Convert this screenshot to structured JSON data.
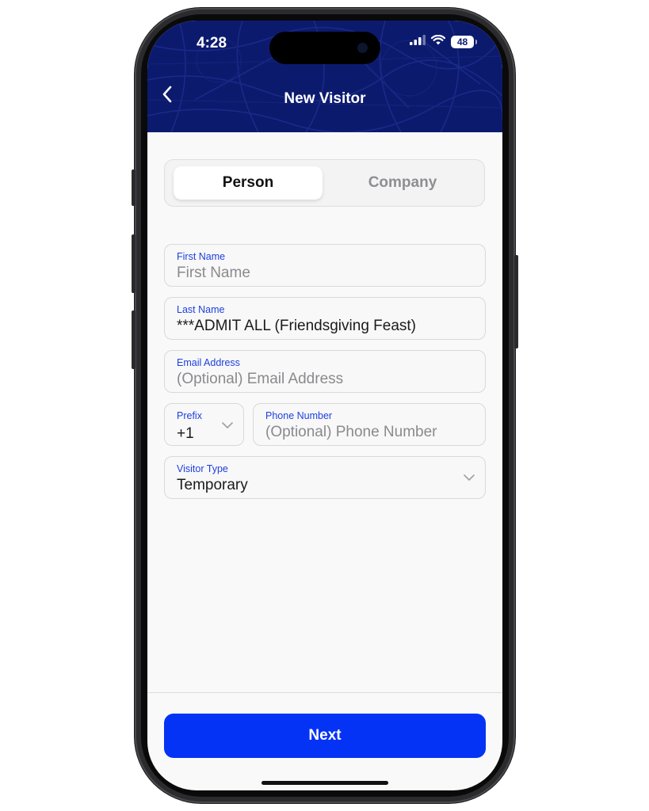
{
  "status_bar": {
    "time": "4:28",
    "battery": "48",
    "icons": [
      "signal-icon",
      "wifi-icon",
      "battery-icon"
    ]
  },
  "header": {
    "title": "New Visitor",
    "back_icon": "chevron-left-icon",
    "background_color": "#0c1a6e"
  },
  "segmented": {
    "options": [
      "Person",
      "Company"
    ],
    "selected": "Person"
  },
  "form": {
    "first_name": {
      "label": "First Name",
      "placeholder": "First Name",
      "value": ""
    },
    "last_name": {
      "label": "Last Name",
      "value": "***ADMIT ALL (Friendsgiving Feast)"
    },
    "email": {
      "label": "Email Address",
      "placeholder": "(Optional) Email Address",
      "value": ""
    },
    "prefix": {
      "label": "Prefix",
      "value": "+1"
    },
    "phone": {
      "label": "Phone Number",
      "placeholder": "(Optional) Phone Number",
      "value": ""
    },
    "visitor_type": {
      "label": "Visitor Type",
      "value": "Temporary"
    }
  },
  "footer": {
    "next_label": "Next"
  },
  "colors": {
    "accent": "#0433f5",
    "label_blue": "#1d3fe0"
  }
}
